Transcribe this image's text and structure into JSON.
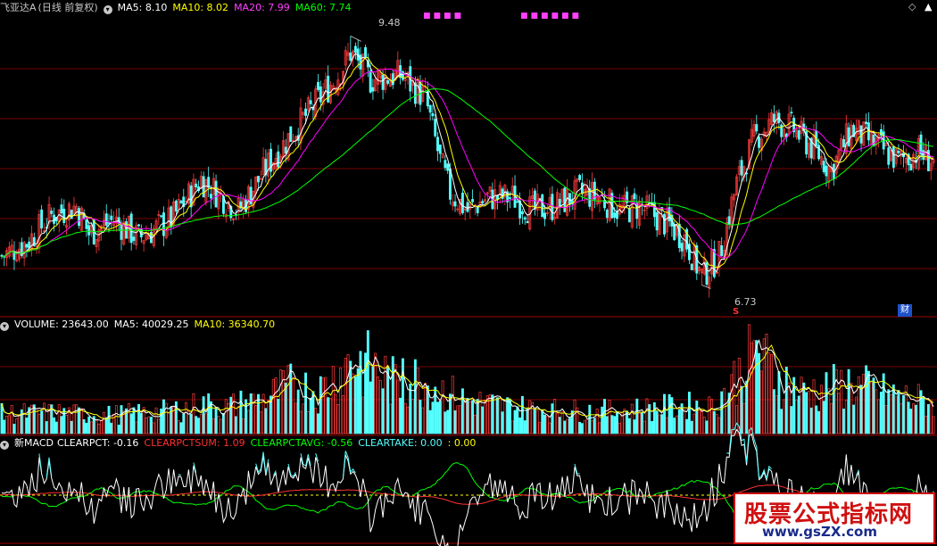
{
  "header_price": {
    "stock_name": "飞亚达A",
    "period": "(日线 前复权)",
    "ma5": "MA5: 8.10",
    "ma10": "MA10: 8.02",
    "ma20": "MA20: 7.99",
    "ma60": "MA60: 7.74"
  },
  "header_volume": {
    "volume": "VOLUME: 23643.00",
    "ma5": "MA5: 40029.25",
    "ma10": "MA10: 36340.70"
  },
  "header_macd": {
    "name": "新MACD",
    "clearpct": "CLEARPCT: -0.16",
    "clearpctsum": "CLEARPCTSUM: 1.09",
    "clearpctavg": "CLEARPCTAVG: -0.56",
    "cleartake": "CLEARTAKE: 0.00",
    "extra": ": 0.00"
  },
  "annotations": {
    "high_label": "9.48",
    "low_label": "6.73",
    "s_marker": "S",
    "finance_badge": "财",
    "diamond_icon": "◇",
    "up_icon": "▲"
  },
  "watermark": {
    "line1": "股票公式指标网",
    "line2": "www.gsZX.com"
  },
  "colors": {
    "up": "#ff3c3c",
    "down": "#54ffff",
    "ma5": "#ffffff",
    "ma10": "#ffff00",
    "ma20": "#ff00ff",
    "ma60": "#00ff00",
    "grid": "#7a0000",
    "sep": "#a00000"
  },
  "chart_data": {
    "type": "candlestick",
    "price_ylim": [
      6.4,
      9.7
    ],
    "volume_ylim": [
      0,
      80000
    ],
    "highest": 9.48,
    "lowest": 6.73,
    "price_anchors": [
      [
        0,
        7.05
      ],
      [
        10,
        7.2
      ],
      [
        20,
        7.5
      ],
      [
        30,
        7.6
      ],
      [
        35,
        7.3
      ],
      [
        45,
        7.45
      ],
      [
        55,
        7.25
      ],
      [
        68,
        7.45
      ],
      [
        80,
        7.9
      ],
      [
        95,
        7.55
      ],
      [
        108,
        8.1
      ],
      [
        122,
        8.6
      ],
      [
        135,
        9.05
      ],
      [
        140,
        9.3
      ],
      [
        148,
        9.0
      ],
      [
        160,
        9.05
      ],
      [
        170,
        8.8
      ],
      [
        176,
        8.1
      ],
      [
        180,
        7.75
      ],
      [
        187,
        7.55
      ],
      [
        195,
        7.7
      ],
      [
        205,
        7.7
      ],
      [
        213,
        7.55
      ],
      [
        222,
        7.6
      ],
      [
        232,
        7.75
      ],
      [
        240,
        7.7
      ],
      [
        248,
        7.55
      ],
      [
        256,
        7.6
      ],
      [
        265,
        7.45
      ],
      [
        274,
        7.25
      ],
      [
        281,
        6.83
      ],
      [
        288,
        7.05
      ],
      [
        295,
        7.85
      ],
      [
        302,
        8.35
      ],
      [
        310,
        8.55
      ],
      [
        318,
        8.45
      ],
      [
        327,
        8.2
      ],
      [
        333,
        8.0
      ],
      [
        341,
        8.45
      ],
      [
        350,
        8.3
      ],
      [
        360,
        8.1
      ],
      [
        368,
        8.2
      ],
      [
        374,
        8.1
      ]
    ],
    "volume_anchors": [
      [
        0,
        15000
      ],
      [
        20,
        16000
      ],
      [
        40,
        14000
      ],
      [
        60,
        16000
      ],
      [
        70,
        18000
      ],
      [
        80,
        22000
      ],
      [
        90,
        20000
      ],
      [
        105,
        26000
      ],
      [
        115,
        36000
      ],
      [
        128,
        33000
      ],
      [
        135,
        46000
      ],
      [
        140,
        56000
      ],
      [
        150,
        50000
      ],
      [
        158,
        38000
      ],
      [
        168,
        42000
      ],
      [
        176,
        34000
      ],
      [
        185,
        26000
      ],
      [
        200,
        21000
      ],
      [
        220,
        18000
      ],
      [
        240,
        17000
      ],
      [
        260,
        19000
      ],
      [
        275,
        21000
      ],
      [
        285,
        20000
      ],
      [
        298,
        50000
      ],
      [
        303,
        62000
      ],
      [
        310,
        46000
      ],
      [
        320,
        32000
      ],
      [
        330,
        33000
      ],
      [
        340,
        38000
      ],
      [
        350,
        33000
      ],
      [
        360,
        28000
      ],
      [
        374,
        23643
      ]
    ],
    "bars": 375
  }
}
